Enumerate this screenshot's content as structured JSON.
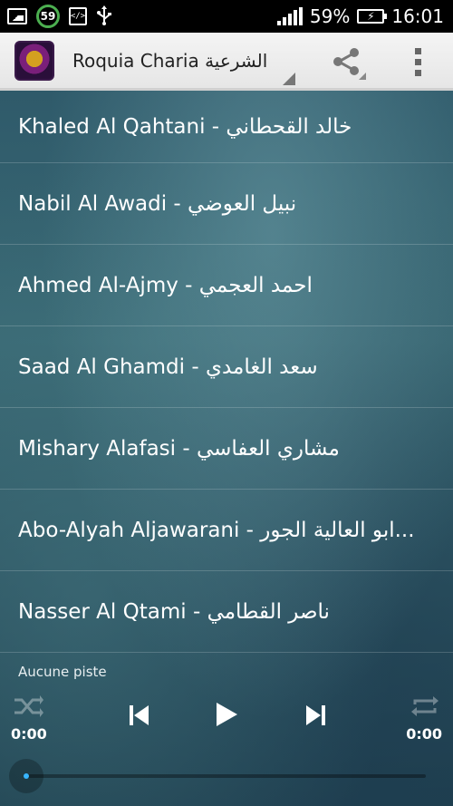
{
  "status_bar": {
    "badge_number": "59",
    "battery_percent": "59%",
    "time": "16:01",
    "icons": [
      "image-icon",
      "counter-badge",
      "code-icon",
      "usb-icon",
      "signal-icon",
      "battery-charging-icon"
    ]
  },
  "action_bar": {
    "title": "Roquia Charia الشرعية",
    "icons": [
      "app-logo",
      "share-icon",
      "overflow-menu-icon"
    ]
  },
  "reciters": [
    {
      "label": "Khaled Al Qahtani - خالد القحطاني"
    },
    {
      "label": "Nabil Al Awadi - نبيل العوضي"
    },
    {
      "label": "Ahmed Al-Ajmy - احمد العجمي"
    },
    {
      "label": "Saad Al Ghamdi - سعد الغامدي"
    },
    {
      "label": "Mishary Alafasi - مشاري العفاسي"
    },
    {
      "label": "Abo-Alyah Aljawarani - ابو العالية الجور..."
    },
    {
      "label": "Nasser Al Qtami - ناصر القطامي"
    }
  ],
  "player": {
    "track_label": "Aucune piste",
    "time_elapsed": "0:00",
    "time_total": "0:00",
    "progress": 0,
    "controls": [
      "shuffle-icon",
      "previous-icon",
      "play-icon",
      "next-icon",
      "repeat-icon"
    ]
  },
  "colors": {
    "accent": "#38b6ff",
    "status_bar_bg": "#000000",
    "action_bar_bg": "#eeeeee"
  }
}
